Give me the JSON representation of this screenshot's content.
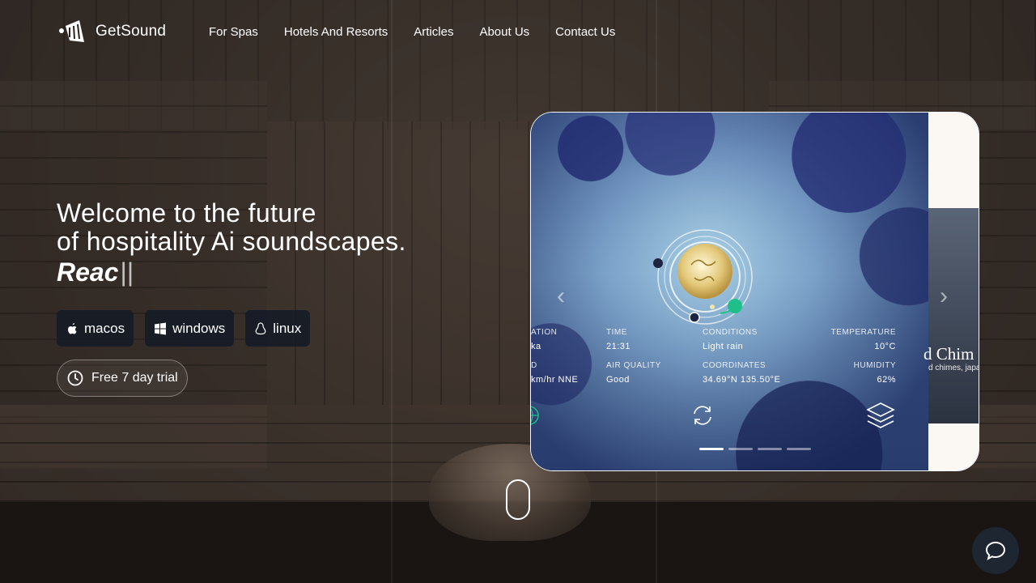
{
  "brand": {
    "name": "GetSound"
  },
  "nav": [
    {
      "label": "For Spas"
    },
    {
      "label": "Hotels And Resorts"
    },
    {
      "label": "Articles"
    },
    {
      "label": "About Us"
    },
    {
      "label": "Contact Us"
    }
  ],
  "hero": {
    "line1": "Welcome to the future",
    "line2": "of hospitality Ai soundscapes.",
    "typed": "Reac",
    "cursor": "||"
  },
  "downloads": [
    {
      "label": "macos",
      "icon": "apple-icon"
    },
    {
      "label": "windows",
      "icon": "windows-icon"
    },
    {
      "label": "linux",
      "icon": "linux-icon"
    }
  ],
  "trial": {
    "label": "Free 7 day trial",
    "icon": "clock-icon"
  },
  "preview": {
    "stats": {
      "location_label": "ATION",
      "location_value": "ka",
      "time_label": "TIME",
      "time_value": "21:31",
      "conditions_label": "CONDITIONS",
      "conditions_value": "Light rain",
      "temperature_label": "TEMPERATURE",
      "temperature_value": "10°C",
      "wind_label": "D",
      "wind_value": "km/hr NNE",
      "air_label": "AIR QUALITY",
      "air_value": "Good",
      "coords_label": "COORDINATES",
      "coords_value": "34.69°N 135.50°E",
      "humidity_label": "HUMIDITY",
      "humidity_value": "62%"
    },
    "next_slide": {
      "title": "d Chim",
      "subtitle": "d chimes, japa"
    },
    "pagination": {
      "count": 4,
      "active": 0
    },
    "colors": {
      "accent_green": "#1fbf8a",
      "panel_border": "#ffffff"
    }
  },
  "chat": {
    "icon": "chat-bubble-icon"
  }
}
